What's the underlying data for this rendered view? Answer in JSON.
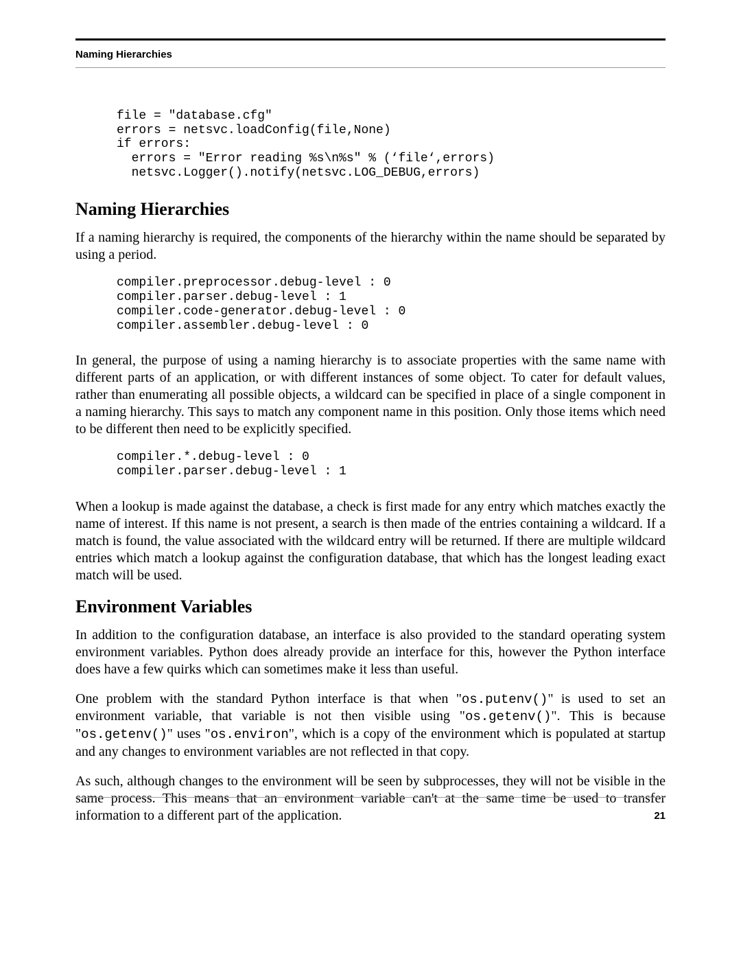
{
  "header": {
    "running_head": "Naming Hierarchies"
  },
  "code": {
    "block1": "file = \"database.cfg\"\nerrors = netsvc.loadConfig(file,None)\nif errors:\n  errors = \"Error reading %s\\n%s\" % (‘file‘,errors)\n  netsvc.Logger().notify(netsvc.LOG_DEBUG,errors)",
    "block2": "compiler.preprocessor.debug-level : 0\ncompiler.parser.debug-level : 1\ncompiler.code-generator.debug-level : 0\ncompiler.assembler.debug-level : 0",
    "block3": "compiler.*.debug-level : 0\ncompiler.parser.debug-level : 1"
  },
  "sections": {
    "naming": {
      "title": "Naming Hierarchies",
      "p1": "If a naming hierarchy is required, the components of the hierarchy within the name should be separated by using a period.",
      "p2": "In general, the purpose of using a naming hierarchy is to associate properties with the same name with different parts of an application, or with different instances of some object. To cater for default values, rather than enumerating all possible objects, a wildcard can be specified in place of a single component in a naming hierarchy. This says to match any component name in this position. Only those items which need to be different then need to be explicitly specified.",
      "p3": "When a lookup is made against the database, a check is first made for any entry which matches exactly the name of interest. If this name is not present, a search is then made of the entries containing a wildcard. If  a match is found, the value associated with the wildcard entry will be returned. If there are multiple wildcard entries which match a lookup against the configuration database, that which has the longest leading exact match will be used."
    },
    "env": {
      "title": "Environment Variables",
      "p1": "In addition to the configuration database, an interface is also provided to the standard operating system environment variables. Python does already provide an interface for this, however the Python interface does have a few quirks which can sometimes make it less than useful.",
      "p2_a": "One problem with the standard Python interface is that when \"",
      "p2_code1": "os.putenv()",
      "p2_b": "\" is used to set an environment variable, that variable is not then visible using \"",
      "p2_code2": "os.getenv()",
      "p2_c": "\". This is because \"",
      "p2_code3": "os.getenv()",
      "p2_d": "\" uses \"",
      "p2_code4": "os.environ",
      "p2_e": "\", which is a copy of the environment which is populated at startup and any changes to environment variables are not reflected in that copy.",
      "p3": "As such, although changes to the environment will be seen by subprocesses, they will not be visible in the same process. This means that an environment variable can't at the same time be used to transfer information to a different part of the application."
    }
  },
  "footer": {
    "page_number": "21"
  }
}
